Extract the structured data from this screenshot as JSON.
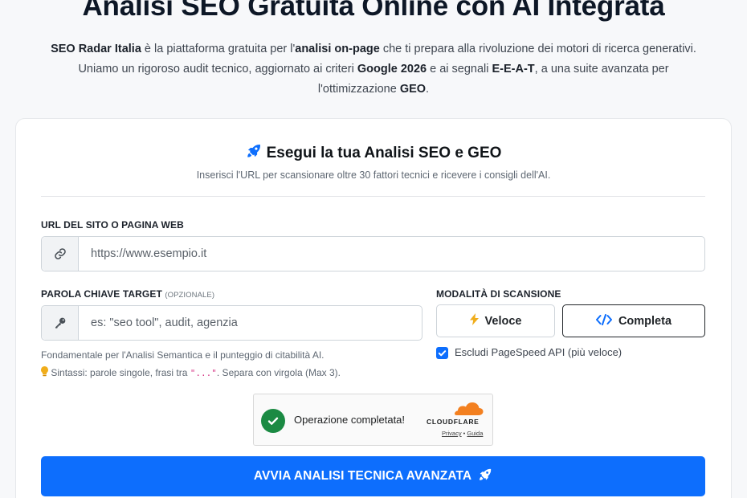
{
  "hero": {
    "title": "Analisi SEO Gratuita Online con AI Integrata",
    "desc": {
      "brand": "SEO Radar Italia",
      "t1": " è la piattaforma gratuita per l'",
      "b1": "analisi on-page",
      "t2": " che ti prepara alla rivoluzione dei motori di ricerca generativi. Uniamo un rigoroso audit tecnico, aggiornato ai criteri ",
      "b2": "Google 2026",
      "t3": " e ai segnali ",
      "b3": "E-E-A-T",
      "t4": ", a una suite avanzata per l'ottimizzazione ",
      "b4": "GEO",
      "t5": "."
    }
  },
  "card": {
    "title": "Esegui la tua Analisi SEO e GEO",
    "subtitle": "Inserisci l'URL per scansionare oltre 30 fattori tecnici e ricevere i consigli dell'AI."
  },
  "url_field": {
    "label": "URL DEL SITO O PAGINA WEB",
    "placeholder": "https://www.esempio.it",
    "value": ""
  },
  "keyword_field": {
    "label": "PAROLA CHIAVE TARGET",
    "label_optional": "(OPZIONALE)",
    "placeholder": "es: \"seo tool\", audit, agenzia",
    "value": "",
    "help_line1": "Fondamentale per l'Analisi Semantica e il punteggio di citabilità AI.",
    "help_line2_a": "Sintassi: parole singole, frasi tra ",
    "help_line2_code": "\"...\"",
    "help_line2_b": ". Separa con virgola (Max 3)."
  },
  "scan_mode": {
    "label": "MODALITÀ DI SCANSIONE",
    "fast_label": "Veloce",
    "full_label": "Completa",
    "selected": "Completa",
    "exclude_pagespeed_label": "Escludi PageSpeed API (più veloce)",
    "exclude_pagespeed_checked": true
  },
  "captcha": {
    "status": "Operazione completata!",
    "provider": "CLOUDFLARE",
    "privacy_link": "Privacy",
    "separator": " • ",
    "help_link": "Guida"
  },
  "submit_label": "AVVIA ANALISI TECNICA AVANZATA",
  "colors": {
    "primary": "#0d6efd",
    "success": "#1b8a43",
    "cloudflare_orange": "#f38020",
    "bolt": "#f0ad1b"
  },
  "icons": {
    "title": "rocket-icon",
    "url": "link-icon",
    "keyword": "key-icon",
    "fast": "bolt-icon",
    "full": "code-icon",
    "hint": "lightbulb-icon",
    "submit": "rocket-icon"
  }
}
